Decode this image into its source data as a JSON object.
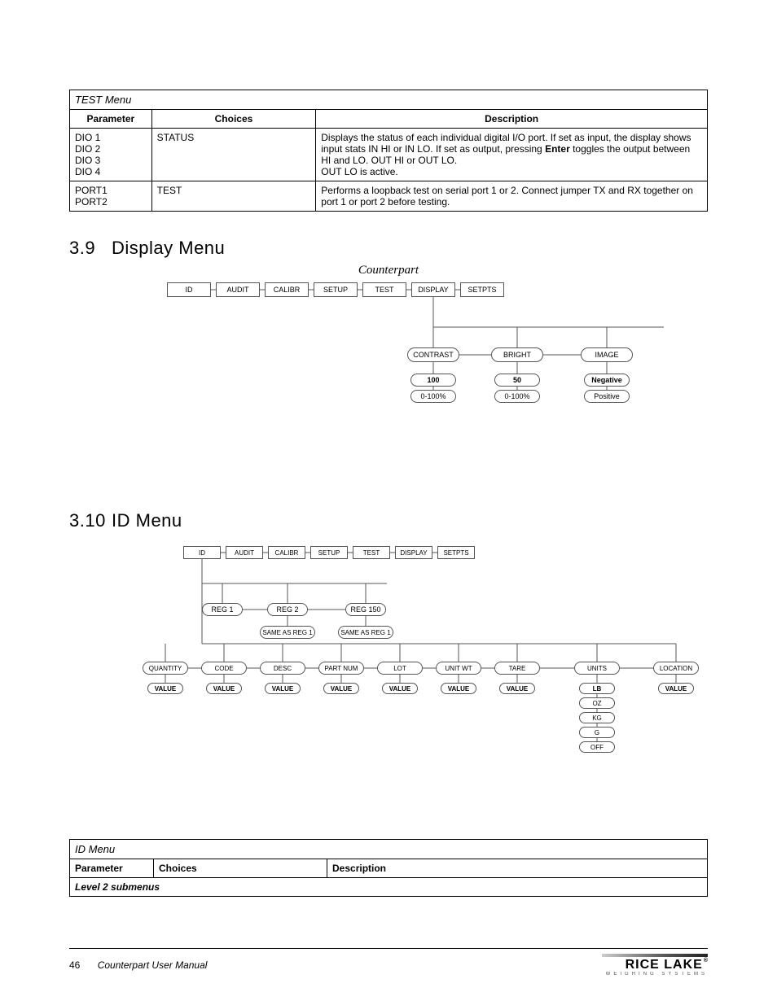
{
  "test_table": {
    "title": "TEST Menu",
    "headers": {
      "param": "Parameter",
      "choices": "Choices",
      "desc": "Description"
    },
    "rows": [
      {
        "param": "DIO 1\nDIO 2\nDIO 3\nDIO 4",
        "choices": "STATUS",
        "desc_pre": "Displays the status of each individual digital I/O port. If set as input, the display shows input stats IN HI or IN LO. If set as output, pressing ",
        "desc_bold": "Enter",
        "desc_post": " toggles the output between HI and LO. OUT HI or OUT LO.\nOUT LO is active."
      },
      {
        "param": "PORT1\nPORT2",
        "choices": "TEST",
        "desc_pre": "Performs a loopback test on serial port 1 or 2. Connect jumper TX and RX together on port 1 or port 2 before testing.",
        "desc_bold": "",
        "desc_post": ""
      }
    ]
  },
  "sec39": {
    "num": "3.9",
    "title": "Display Menu",
    "fig_title": "Counterpart"
  },
  "diag1": {
    "top": [
      "ID",
      "AUDIT",
      "CALIBR",
      "SETUP",
      "TEST",
      "DISPLAY",
      "SETPTS"
    ],
    "mid": [
      "CONTRAST",
      "BRIGHT",
      "IMAGE"
    ],
    "vals": [
      "100",
      "50",
      "Negative"
    ],
    "opts": [
      "0-100%",
      "0-100%",
      "Positive"
    ]
  },
  "sec310": {
    "num": "3.10",
    "title": "ID Menu"
  },
  "diag2": {
    "top": [
      "ID",
      "AUDIT",
      "CALIBR",
      "SETUP",
      "TEST",
      "DISPLAY",
      "SETPTS"
    ],
    "regs": [
      "REG 1",
      "REG 2",
      "REG 150"
    ],
    "same": [
      "SAME AS REG 1",
      "SAME AS REG 1"
    ],
    "fields": [
      "QUANTITY",
      "CODE",
      "DESC",
      "PART NUM",
      "LOT",
      "UNIT WT",
      "TARE",
      "UNITS",
      "LOCATION"
    ],
    "vals": [
      "VALUE",
      "VALUE",
      "VALUE",
      "VALUE",
      "VALUE",
      "VALUE",
      "VALUE",
      "LB",
      "VALUE"
    ],
    "units": [
      "OZ",
      "KG",
      "G",
      "OFF"
    ]
  },
  "id_table": {
    "title": "ID Menu",
    "headers": {
      "param": "Parameter",
      "choices": "Choices",
      "desc": "Description"
    },
    "sub": "Level 2 submenus"
  },
  "footer": {
    "page": "46",
    "doc": "Counterpart User Manual",
    "logo_name": "RICE LAKE",
    "logo_tag": "WEIGHING SYSTEMS"
  },
  "chart_data": [
    {
      "type": "table",
      "title": "TEST Menu",
      "columns": [
        "Parameter",
        "Choices",
        "Description"
      ],
      "rows": [
        [
          "DIO 1 / DIO 2 / DIO 3 / DIO 4",
          "STATUS",
          "Displays the status of each individual digital I/O port. If set as input, the display shows input stats IN HI or IN LO. If set as output, pressing Enter toggles the output between HI and LO. OUT HI or OUT LO. OUT LO is active."
        ],
        [
          "PORT1 / PORT2",
          "TEST",
          "Performs a loopback test on serial port 1 or 2. Connect jumper TX and RX together on port 1 or port 2 before testing."
        ]
      ]
    },
    {
      "type": "tree",
      "title": "Display Menu (Counterpart)",
      "root_path": [
        "ID",
        "AUDIT",
        "CALIBR",
        "SETUP",
        "TEST",
        "DISPLAY",
        "SETPTS"
      ],
      "active_branch": "DISPLAY",
      "children": [
        {
          "name": "CONTRAST",
          "default": "100",
          "range": "0-100%"
        },
        {
          "name": "BRIGHT",
          "default": "50",
          "range": "0-100%"
        },
        {
          "name": "IMAGE",
          "default": "Negative",
          "options": [
            "Negative",
            "Positive"
          ]
        }
      ]
    },
    {
      "type": "tree",
      "title": "ID Menu",
      "root_path": [
        "ID",
        "AUDIT",
        "CALIBR",
        "SETUP",
        "TEST",
        "DISPLAY",
        "SETPTS"
      ],
      "active_branch": "ID",
      "children": [
        {
          "name": "REG 1",
          "fields": [
            {
              "name": "QUANTITY",
              "value": "VALUE"
            },
            {
              "name": "CODE",
              "value": "VALUE"
            },
            {
              "name": "DESC",
              "value": "VALUE"
            },
            {
              "name": "PART NUM",
              "value": "VALUE"
            },
            {
              "name": "LOT",
              "value": "VALUE"
            },
            {
              "name": "UNIT WT",
              "value": "VALUE"
            },
            {
              "name": "TARE",
              "value": "VALUE"
            },
            {
              "name": "UNITS",
              "default": "LB",
              "options": [
                "LB",
                "OZ",
                "KG",
                "G",
                "OFF"
              ]
            },
            {
              "name": "LOCATION",
              "value": "VALUE"
            }
          ]
        },
        {
          "name": "REG 2",
          "note": "SAME AS REG 1"
        },
        {
          "name": "REG 150",
          "note": "SAME AS REG 1"
        }
      ]
    },
    {
      "type": "table",
      "title": "ID Menu",
      "columns": [
        "Parameter",
        "Choices",
        "Description"
      ],
      "rows": [],
      "subheading": "Level 2 submenus"
    }
  ]
}
